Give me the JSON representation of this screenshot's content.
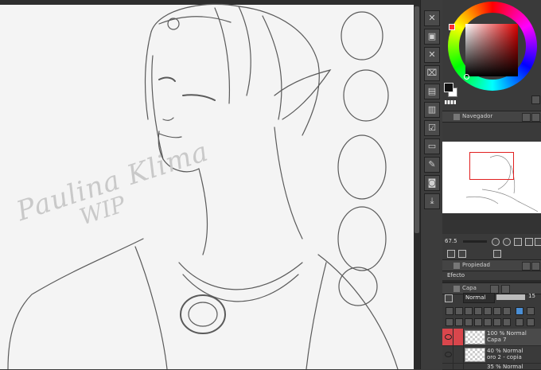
{
  "artwork": {
    "signature_name": "Paulina Klima",
    "signature_note": "WIP"
  },
  "toolstrip": {
    "buttons": [
      {
        "icon": "delete-icon"
      },
      {
        "icon": "copy-icon"
      },
      {
        "icon": "save-icon"
      },
      {
        "icon": "cut-icon"
      },
      {
        "icon": "export-icon"
      },
      {
        "icon": "paste-icon"
      },
      {
        "icon": "checklist-icon"
      },
      {
        "icon": "folder-icon"
      },
      {
        "icon": "folder-edit-icon"
      },
      {
        "icon": "folder-new-icon"
      },
      {
        "icon": "camera-icon"
      },
      {
        "icon": "download-icon"
      }
    ]
  },
  "color_panel": {
    "hue_color": "#ff0000",
    "main_color": "#111111",
    "sub_color": "#ffffff"
  },
  "navigator": {
    "tab_label": "Navegador",
    "zoom_value": "67.5"
  },
  "properties": {
    "tab_label": "Propiedad",
    "effect_label": "Efecto"
  },
  "layers": {
    "tab_label": "Capa",
    "blend_mode": "Normal",
    "opacity_value": "15",
    "items": [
      {
        "line1": "100 % Normal",
        "line2": "Capa 7",
        "active": true
      },
      {
        "line1": "40 % Normal",
        "line2": "oro  2 - copia",
        "active": false
      },
      {
        "line1": "35 % Normal",
        "line2": "",
        "active": false
      }
    ]
  }
}
